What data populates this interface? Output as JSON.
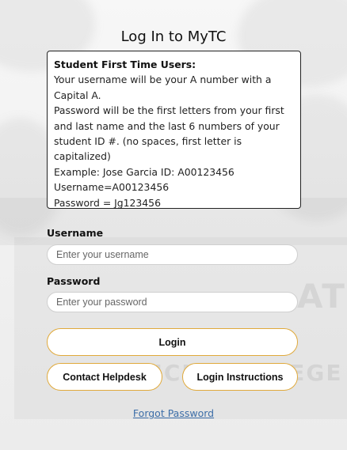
{
  "page": {
    "title": "Log In to MyTC"
  },
  "notice": {
    "heading": "Student First Time Users:",
    "lines": [
      "Your username will be your A number with a",
      "Capital A.",
      "Password will be the first letters from your first",
      "and last name and the last 6 numbers of your",
      "student ID #. (no spaces, first letter is capitalized)",
      "Example: Jose Garcia ID: A00123456",
      "Username=A00123456",
      "Password = Jg123456"
    ]
  },
  "form": {
    "username_label": "Username",
    "username_placeholder": "Enter your username",
    "username_value": "",
    "password_label": "Password",
    "password_placeholder": "Enter your password",
    "password_value": "",
    "login_label": "Login",
    "helpdesk_label": "Contact Helpdesk",
    "instructions_label": "Login Instructions",
    "forgot_label": "Forgot Password"
  },
  "colors": {
    "button_border": "#e0a93a",
    "link": "#3d6ea8"
  }
}
